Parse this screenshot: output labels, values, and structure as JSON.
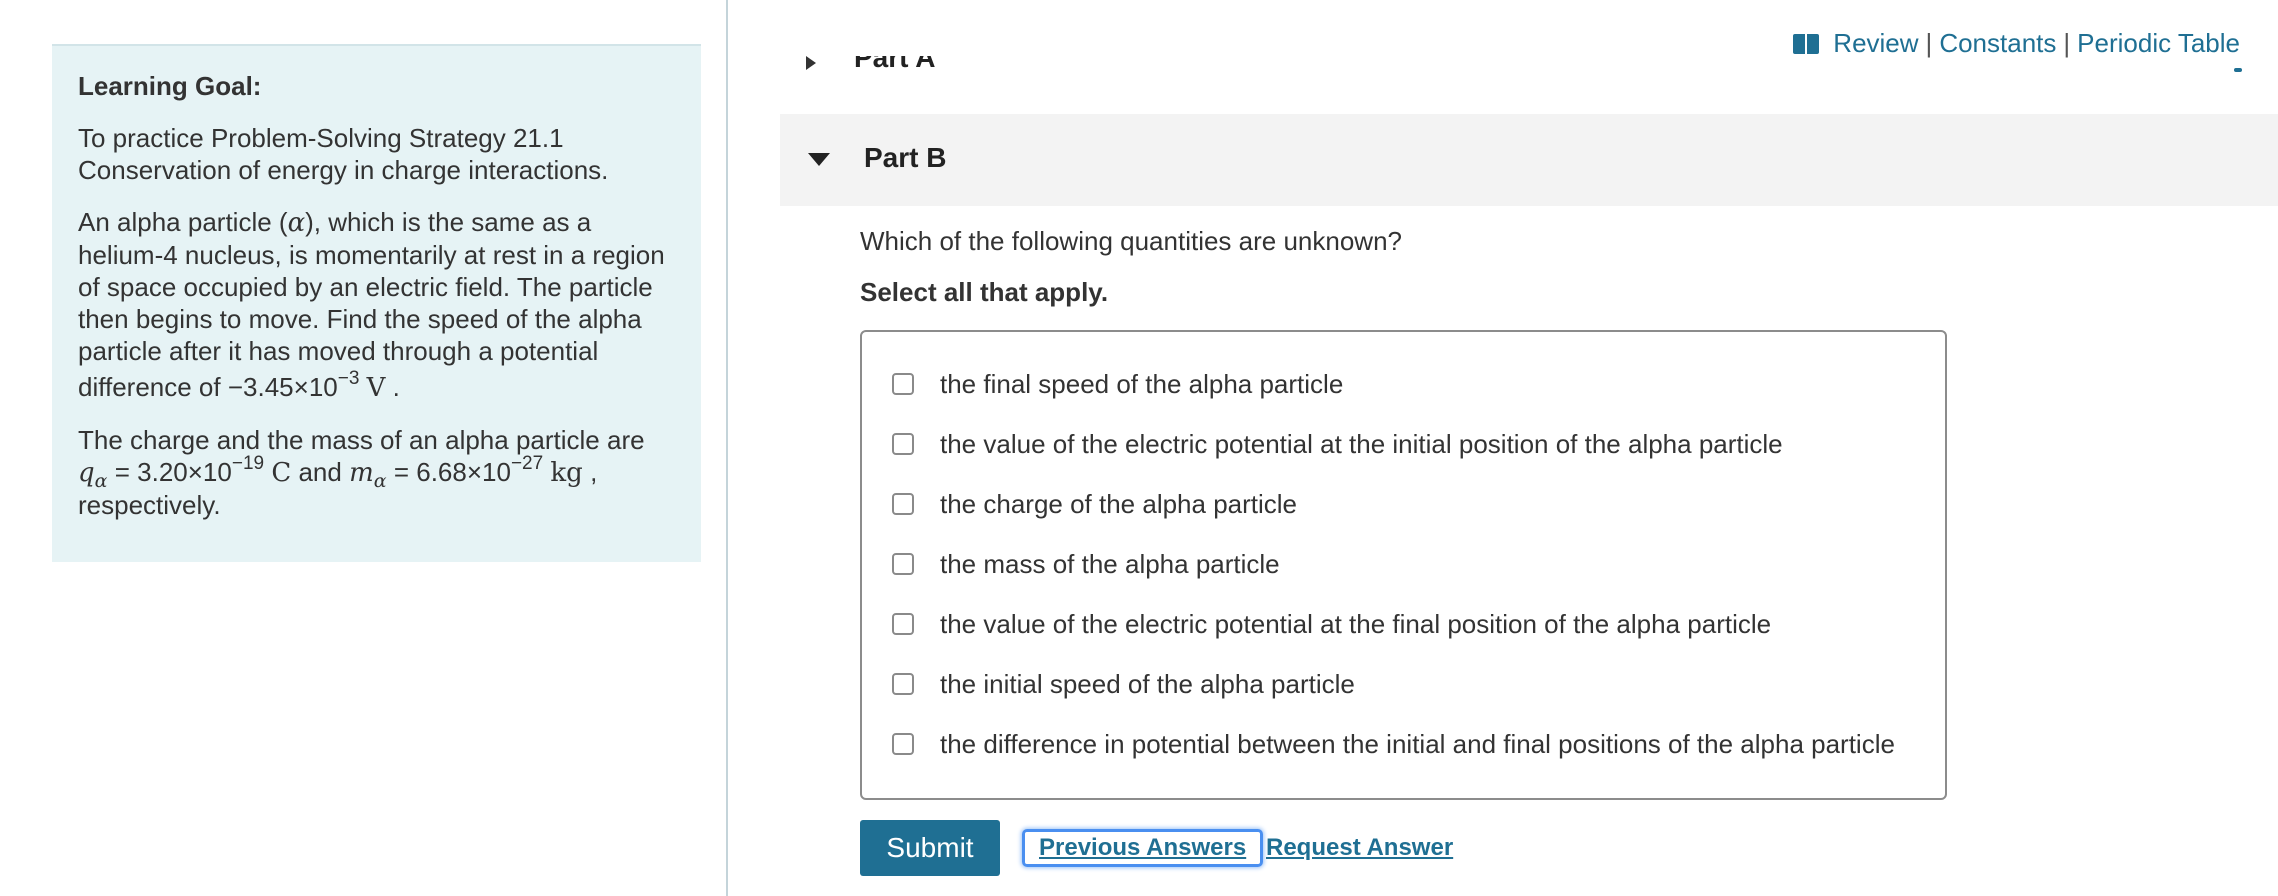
{
  "learning_goal": {
    "title": "Learning Goal:",
    "intro_line1": "To practice Problem-Solving Strategy 21.1",
    "intro_line2": "Conservation of energy in charge interactions.",
    "problem": {
      "line1_a": "An alpha particle (",
      "line1_sym": "α",
      "line1_b": "), which is the same as a",
      "line2": "helium-4 nucleus, is momentarily at rest in a region",
      "line3": "of space occupied by an electric field. The particle",
      "line4": "then begins to move. Find the speed of the alpha",
      "line5": "particle after it has moved through a potential",
      "line6_prefix": "difference of ",
      "potential_mantissa": "−3.45×10",
      "potential_exponent": "−3",
      "potential_unit": "V",
      "period": "."
    },
    "constants": {
      "line1": "The charge and the mass of an alpha particle are",
      "q_symbol": "q",
      "q_sub": "α",
      "q_value": "= 3.20×10",
      "q_exponent": "−19",
      "q_unit": "C",
      "and_text": "and",
      "m_symbol": "m",
      "m_sub": "α",
      "m_value": "= 6.68×10",
      "m_exponent": "−27",
      "m_unit": "kg",
      "comma": ",",
      "line3": "respectively."
    }
  },
  "header_links": {
    "review": "Review",
    "constants": "Constants",
    "periodic_table": "Periodic Table",
    "separator": "|",
    "icon": "book-icon"
  },
  "part_a": {
    "title": "Part A"
  },
  "part_b": {
    "title": "Part B",
    "question": "Which of the following quantities are unknown?",
    "instruction": "Select all that apply.",
    "options": [
      "the final speed of the alpha particle",
      "the value of the electric potential at the initial position of the alpha particle",
      "the charge of the alpha particle",
      "the mass of the alpha particle",
      "the value of the electric potential at the final position of the alpha particle",
      "the initial speed of the alpha particle",
      "the difference in potential between the initial and final positions of the alpha particle"
    ]
  },
  "actions": {
    "submit": "Submit",
    "previous_answers": "Previous Answers",
    "request_answer": "Request Answer"
  },
  "colors": {
    "panel_bg": "#e6f3f5",
    "link": "#1f6f93",
    "submit_bg": "#1f6f93",
    "focus_ring": "#4a8ff0"
  }
}
